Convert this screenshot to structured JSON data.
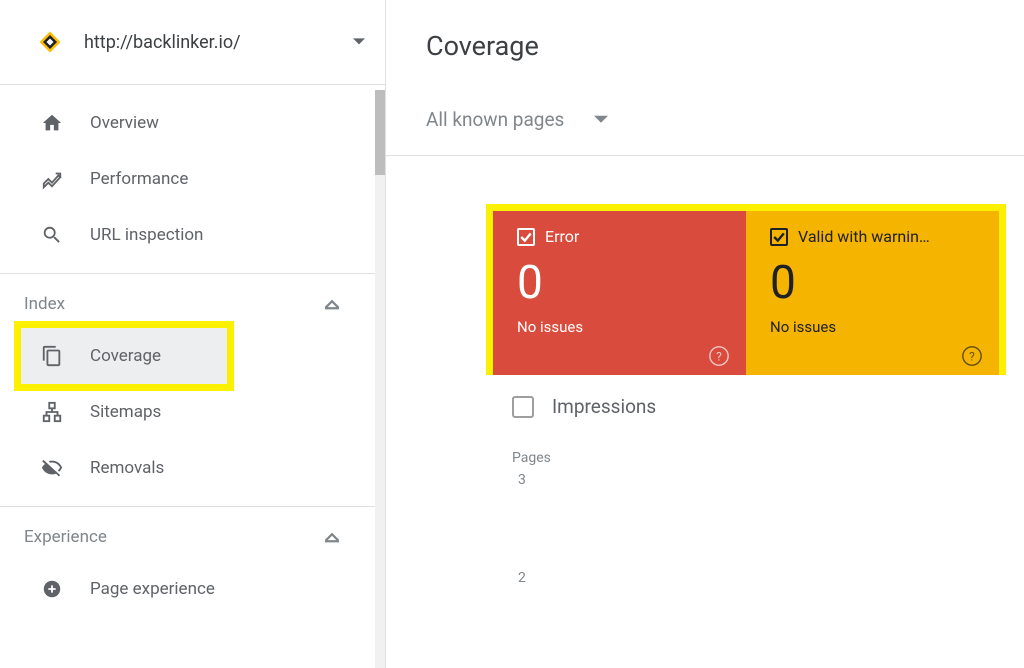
{
  "property": {
    "url": "http://backlinker.io/"
  },
  "sidebar": {
    "items": {
      "overview": "Overview",
      "performance": "Performance",
      "url_inspection": "URL inspection",
      "coverage": "Coverage",
      "sitemaps": "Sitemaps",
      "removals": "Removals",
      "page_experience": "Page experience"
    },
    "sections": {
      "index": "Index",
      "experience": "Experience"
    }
  },
  "page": {
    "title": "Coverage",
    "filter": "All known pages"
  },
  "cards": {
    "error": {
      "label": "Error",
      "count": "0",
      "sub": "No issues"
    },
    "warning": {
      "label": "Valid with warnin…",
      "count": "0",
      "sub": "No issues"
    }
  },
  "impressions": {
    "label": "Impressions",
    "checked": false
  },
  "chart_data": {
    "type": "line",
    "title": "Pages",
    "xlabel": "",
    "ylabel": "Pages",
    "ylim": [
      2,
      3
    ],
    "y_ticks": [
      "3",
      "2"
    ],
    "series": [
      {
        "name": "Error",
        "values": []
      },
      {
        "name": "Valid with warnings",
        "values": []
      }
    ]
  },
  "colors": {
    "error": "#d94c3d",
    "warning": "#f4b400",
    "highlight": "#fbf000"
  }
}
